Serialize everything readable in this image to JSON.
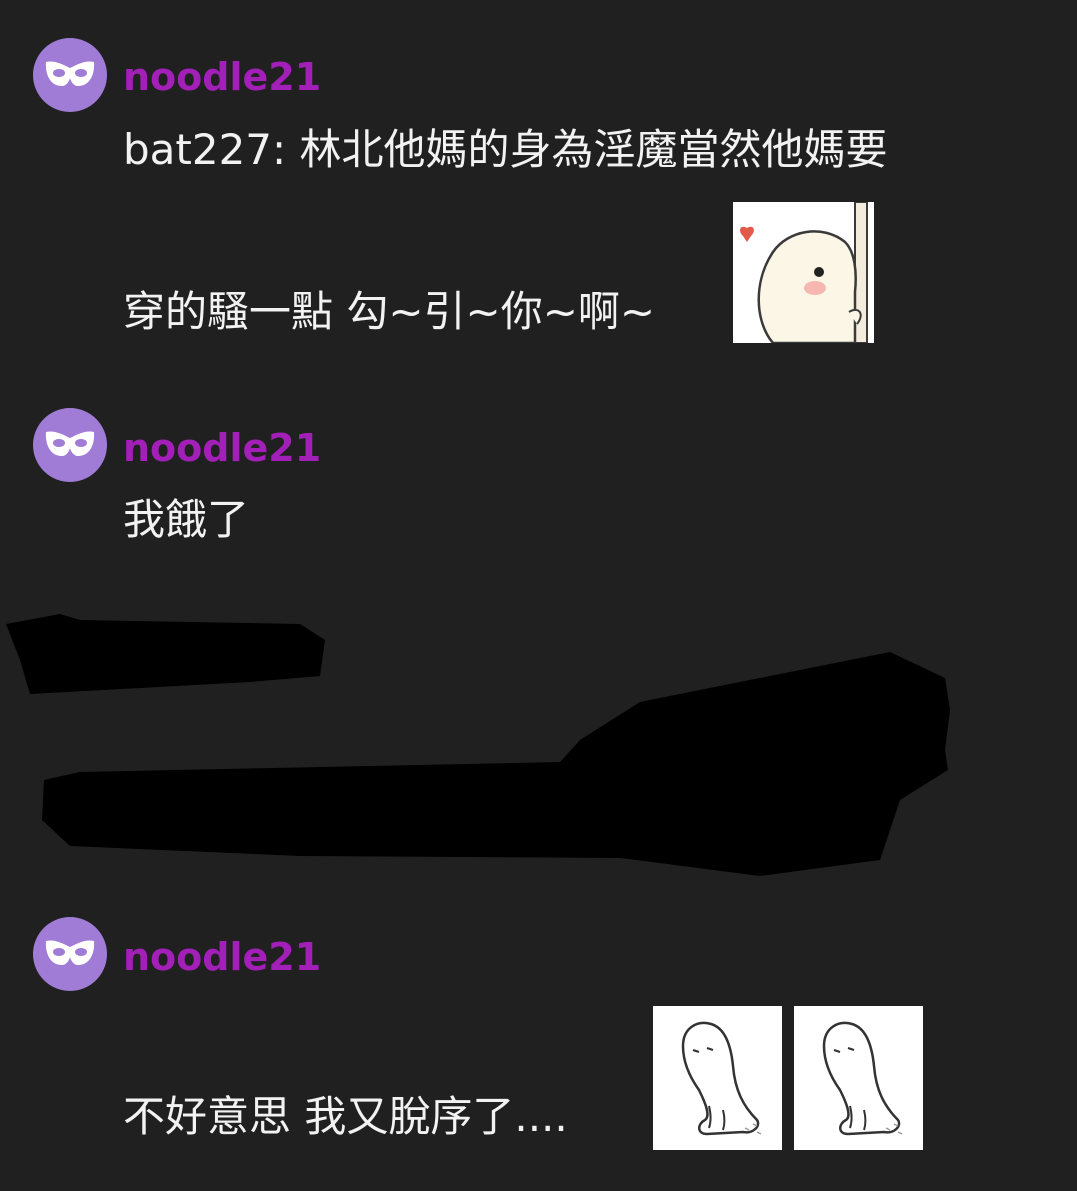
{
  "messages": [
    {
      "username": "noodle21",
      "lines": [
        "bat227: 林北他媽的身為淫魔當然他媽要",
        "穿的騷一點 勾~引~你~啊~"
      ],
      "stickers": [
        "peeking-blob-heart-sticker"
      ]
    },
    {
      "username": "noodle21",
      "lines": [
        "我餓了"
      ]
    },
    {
      "username": "noodle21",
      "lines": [
        "不好意思 我又脫序了...."
      ],
      "stickers": [
        "sad-ghost-sticker",
        "sad-ghost-sticker"
      ]
    }
  ],
  "colors": {
    "background": "#202020",
    "username": "#a21fb8",
    "avatar": "#a07cd6",
    "text": "#f2f2f2",
    "redaction": "#000000"
  },
  "icons": {
    "avatar": "mask-icon"
  }
}
